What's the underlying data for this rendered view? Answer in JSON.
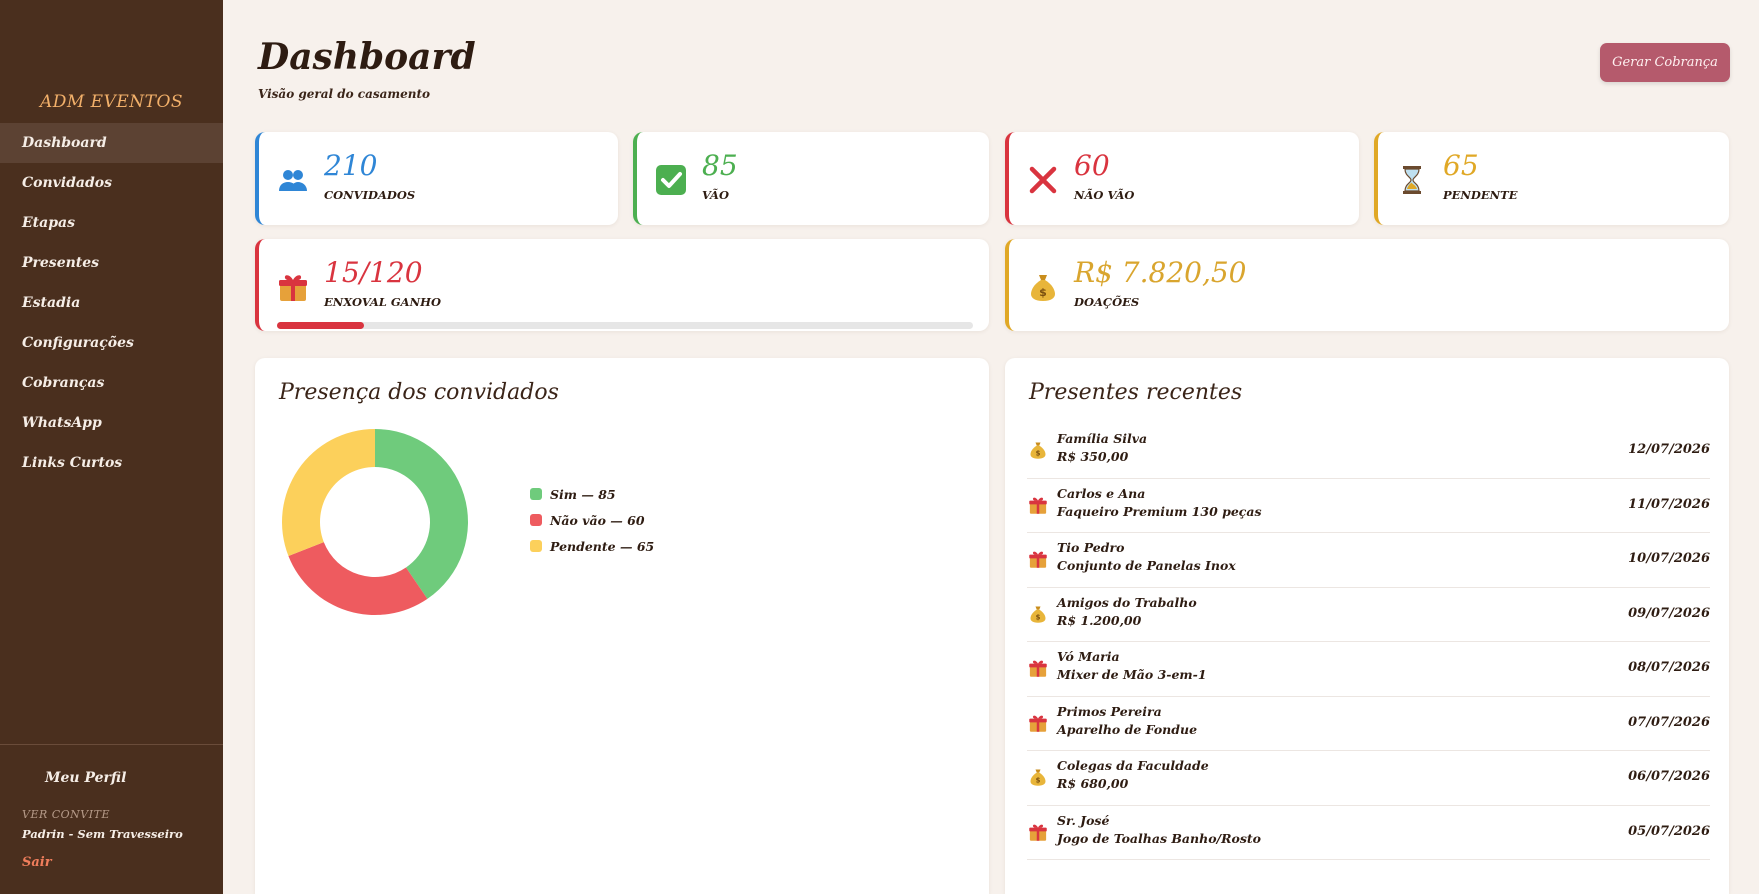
{
  "sidebar": {
    "brand": "ADM EVENTOS",
    "items": [
      {
        "label": "Dashboard",
        "active": true
      },
      {
        "label": "Convidados"
      },
      {
        "label": "Etapas"
      },
      {
        "label": "Presentes"
      },
      {
        "label": "Estadia"
      },
      {
        "label": "Configurações"
      },
      {
        "label": "Cobranças"
      },
      {
        "label": "WhatsApp"
      },
      {
        "label": "Links Curtos"
      }
    ],
    "profile": "Meu Perfil",
    "invite_label": "VER CONVITE",
    "invite_value": "Padrin  -  Sem Travesseiro",
    "logout": "Sair"
  },
  "header": {
    "title": "Dashboard",
    "subtitle": "Visão geral do casamento",
    "charge_button": "Gerar Cobrança"
  },
  "stats": {
    "guests": {
      "value": "210",
      "label": "CONVIDADOS",
      "icon": "people-icon",
      "color": "#2f86d6"
    },
    "going": {
      "value": "85",
      "label": "VÃO",
      "icon": "check-icon",
      "color": "#4caf50"
    },
    "not_going": {
      "value": "60",
      "label": "NÃO VÃO",
      "icon": "cross-icon",
      "color": "#d9343f"
    },
    "pending": {
      "value": "65",
      "label": "PENDENTE",
      "icon": "hourglass-icon",
      "color": "#e0a826"
    },
    "trousseau": {
      "value": "15/120",
      "label": "ENXOVAL GANHO",
      "icon": "gift-icon",
      "color": "#d9343f",
      "progress": 0.125
    },
    "donations": {
      "value": "R$ 7.820,50",
      "label": "DOAÇÕES",
      "icon": "money-bag-icon",
      "color": "#d9a52e"
    }
  },
  "presence": {
    "title": "Presença dos convidados"
  },
  "chart_data": {
    "type": "pie",
    "donut": true,
    "categories": [
      "Sim",
      "Não vão",
      "Pendente"
    ],
    "values": [
      85,
      60,
      65
    ],
    "legend_labels": [
      "Sim — 85",
      "Não vão — 60",
      "Pendente — 65"
    ],
    "colors": [
      "#6fcb7c",
      "#ee5b5f",
      "#fcd05b"
    ],
    "legend_placement": "right"
  },
  "recent_gifts": {
    "title": "Presentes recentes",
    "items": [
      {
        "type": "money",
        "name": "Família Silva",
        "desc": "R$ 350,00",
        "date": "12/07/2026"
      },
      {
        "type": "gift",
        "name": "Carlos e Ana",
        "desc": "Faqueiro Premium 130 peças",
        "date": "11/07/2026"
      },
      {
        "type": "gift",
        "name": "Tio Pedro",
        "desc": "Conjunto de Panelas Inox",
        "date": "10/07/2026"
      },
      {
        "type": "money",
        "name": "Amigos do Trabalho",
        "desc": "R$ 1.200,00",
        "date": "09/07/2026"
      },
      {
        "type": "gift",
        "name": "Vó Maria",
        "desc": "Mixer de Mão 3-em-1",
        "date": "08/07/2026"
      },
      {
        "type": "gift",
        "name": "Primos Pereira",
        "desc": "Aparelho de Fondue",
        "date": "07/07/2026"
      },
      {
        "type": "money",
        "name": "Colegas da Faculdade",
        "desc": "R$ 680,00",
        "date": "06/07/2026"
      },
      {
        "type": "gift",
        "name": "Sr. José",
        "desc": "Jogo de Toalhas Banho/Rosto",
        "date": "05/07/2026"
      }
    ]
  }
}
